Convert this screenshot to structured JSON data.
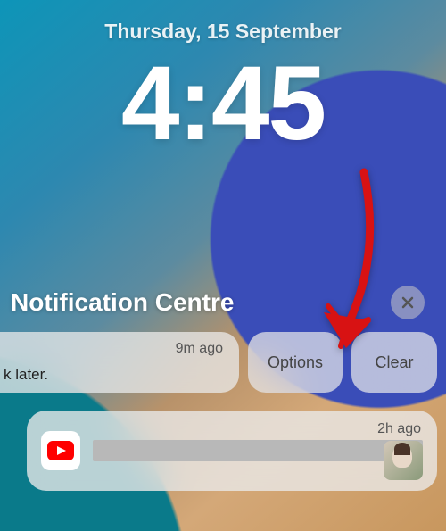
{
  "lockscreen": {
    "date": "Thursday, 15 September",
    "time": "4:45"
  },
  "notification_centre": {
    "title": "Notification Centre",
    "close_label": "×"
  },
  "swiped_notification": {
    "timestamp": "9m ago",
    "snippet": "k later.",
    "options_label": "Options",
    "clear_label": "Clear"
  },
  "second_notification": {
    "app": "youtube",
    "timestamp": "2h ago"
  },
  "annotation": {
    "arrow_target": "clear-button",
    "arrow_color": "#d81213"
  }
}
